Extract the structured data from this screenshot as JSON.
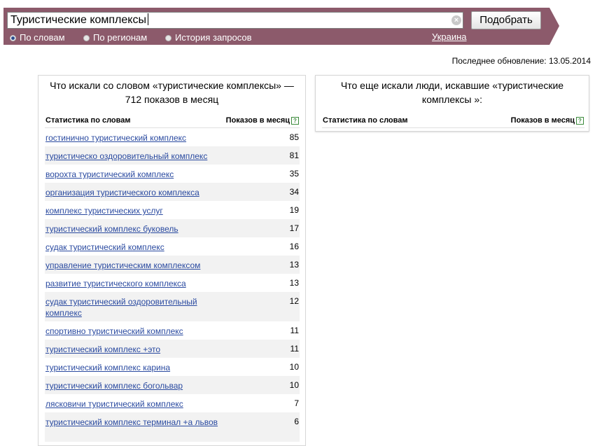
{
  "search": {
    "query": "Туристические комплексы",
    "clear_icon": "×",
    "button_label": "Подобрать",
    "region": "Украина",
    "tabs": [
      {
        "label": "По словам",
        "selected": true
      },
      {
        "label": "По регионам",
        "selected": false
      },
      {
        "label": "История запросов",
        "selected": false
      }
    ]
  },
  "updated": "Последнее обновление: 13.05.2014",
  "left_panel": {
    "title": "Что искали со словом «туристические комплексы» — 712 показов в месяц",
    "col_left": "Статистика по словам",
    "col_right": "Показов в месяц",
    "help": "?",
    "rows": [
      {
        "keyword": "гостинично туристический комплекс",
        "count": "85"
      },
      {
        "keyword": "туристическо оздоровительный комплекс",
        "count": "81"
      },
      {
        "keyword": "ворохта туристический комплекс",
        "count": "35"
      },
      {
        "keyword": "организация туристического комплекса",
        "count": "34"
      },
      {
        "keyword": "комплекс туристических услуг",
        "count": "19"
      },
      {
        "keyword": "туристический комплекс буковель",
        "count": "17"
      },
      {
        "keyword": "судак туристический комплекс",
        "count": "16"
      },
      {
        "keyword": "управление туристическим комплексом",
        "count": "13"
      },
      {
        "keyword": "развитие туристического комплекса",
        "count": "13"
      },
      {
        "keyword": "судак туристический оздоровительный комплекс",
        "count": "12"
      },
      {
        "keyword": "спортивно туристический комплекс",
        "count": "11"
      },
      {
        "keyword": "туристический комплекс +это",
        "count": "11"
      },
      {
        "keyword": "туристический комплекс карина",
        "count": "10"
      },
      {
        "keyword": "туристический комплекс богольвар",
        "count": "10"
      },
      {
        "keyword": "лясковичи туристический комплекс",
        "count": "7"
      },
      {
        "keyword": "туристический комплекс терминал +а львов",
        "count": "6"
      }
    ]
  },
  "right_panel": {
    "title": "Что еще искали люди, искавшие «туристические комплексы »:",
    "col_left": "Статистика по словам",
    "col_right": "Показов в месяц",
    "help": "?"
  },
  "colors": {
    "bar": "#8c5a6b",
    "link": "#2a4aa0",
    "row_alt": "#f2f2f2"
  }
}
